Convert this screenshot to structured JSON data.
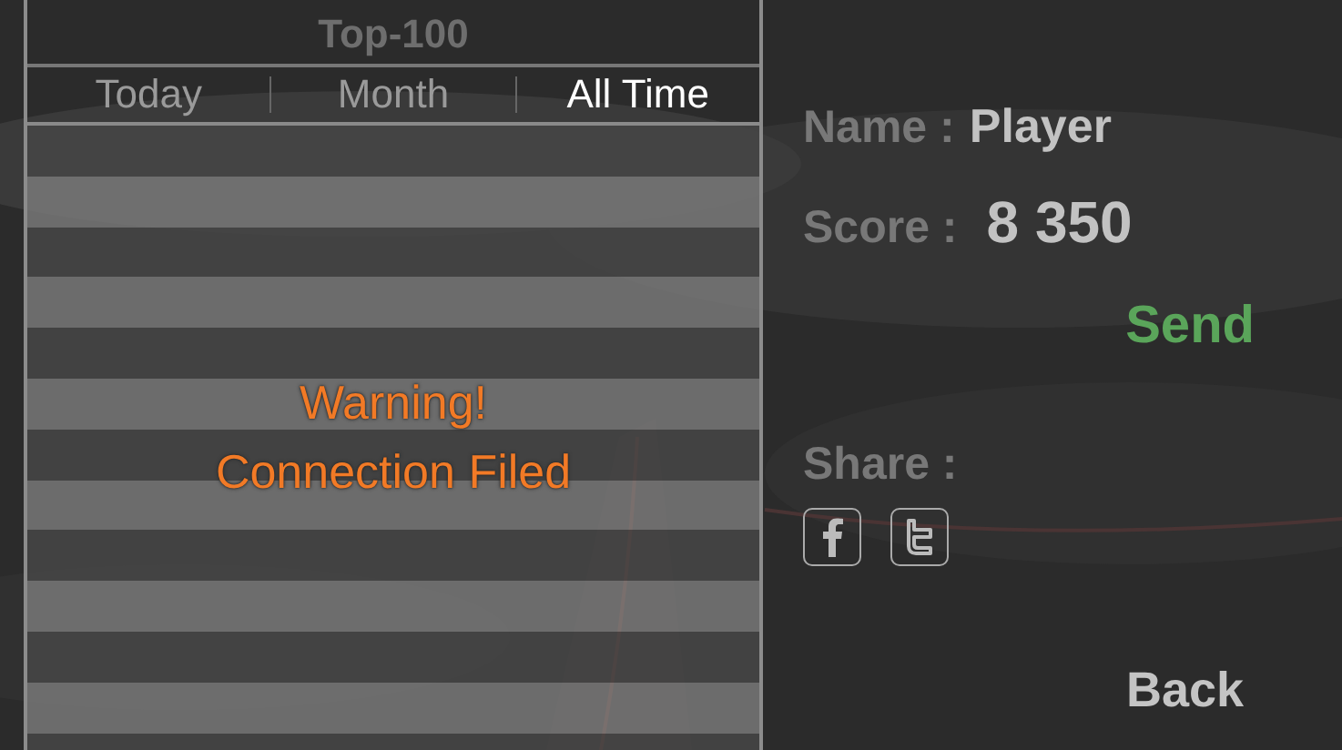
{
  "leaderboard": {
    "title": "Top-100",
    "tabs": [
      {
        "label": "Today",
        "selected": false
      },
      {
        "label": "Month",
        "selected": false
      },
      {
        "label": "All Time",
        "selected": true
      }
    ],
    "warning": {
      "title": "Warning!",
      "message": "Connection Filed"
    }
  },
  "player": {
    "name_label": "Name :",
    "name": "Player",
    "score_label": "Score :",
    "score": "8 350"
  },
  "send_button": "Send",
  "share": {
    "label": "Share :",
    "buttons": [
      {
        "kind": "facebook"
      },
      {
        "kind": "twitter"
      }
    ]
  },
  "back_button": "Back"
}
